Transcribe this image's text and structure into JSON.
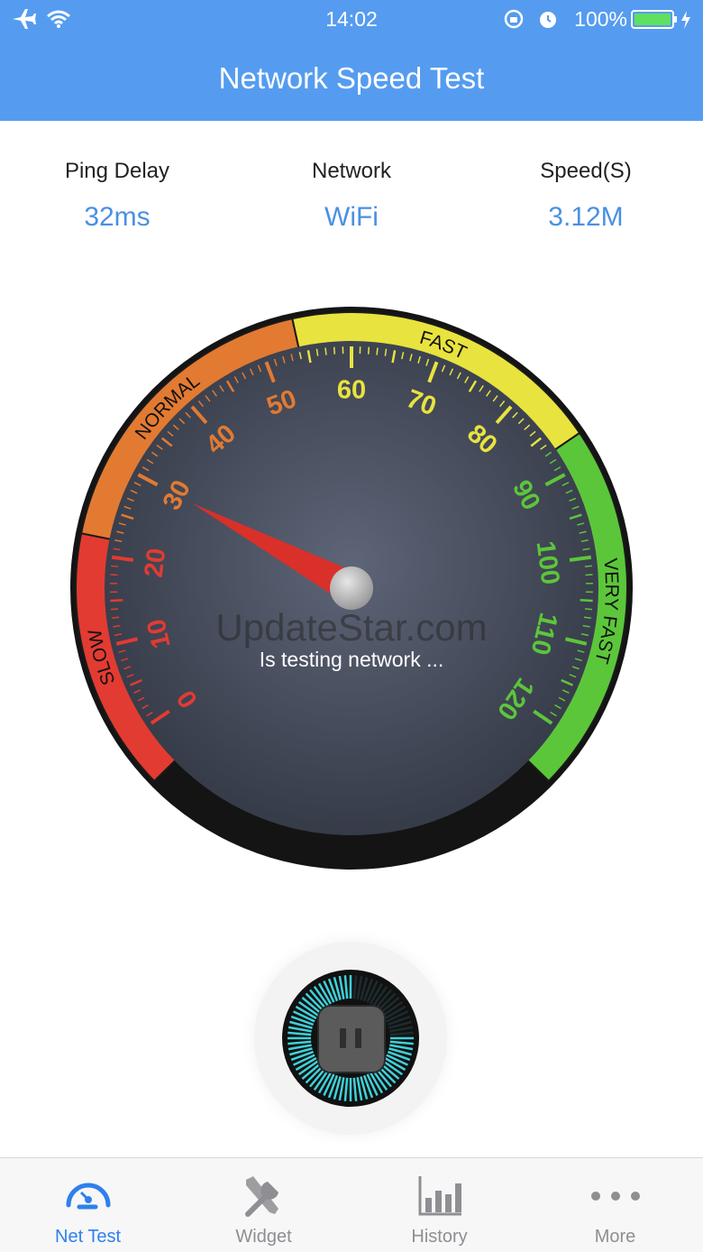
{
  "status_bar": {
    "time": "14:02",
    "battery": "100%"
  },
  "header": {
    "title": "Network Speed Test"
  },
  "stats": [
    {
      "label": "Ping Delay",
      "value": "32ms"
    },
    {
      "label": "Network",
      "value": "WiFi"
    },
    {
      "label": "Speed(S)",
      "value": "3.12M"
    }
  ],
  "gauge": {
    "zone_labels": [
      "SLOW",
      "NORMAL",
      "FAST",
      "VERY FAST"
    ],
    "ticks": [
      "0",
      "10",
      "20",
      "30",
      "40",
      "50",
      "60",
      "70",
      "80",
      "90",
      "100",
      "110",
      "120"
    ],
    "needle_value": 30,
    "status_text": "Is testing network ...",
    "watermark": "UpdateStar.com",
    "colors": {
      "slow": "#e23b32",
      "normal": "#e27a32",
      "fast": "#e8e33e",
      "very_fast": "#5cc63a"
    }
  },
  "control": {
    "icon": "pause-icon"
  },
  "tabs": [
    {
      "label": "Net Test",
      "icon": "speedometer-icon",
      "active": true
    },
    {
      "label": "Widget",
      "icon": "tools-icon",
      "active": false
    },
    {
      "label": "History",
      "icon": "bar-chart-icon",
      "active": false
    },
    {
      "label": "More",
      "icon": "more-dots-icon",
      "active": false
    }
  ]
}
